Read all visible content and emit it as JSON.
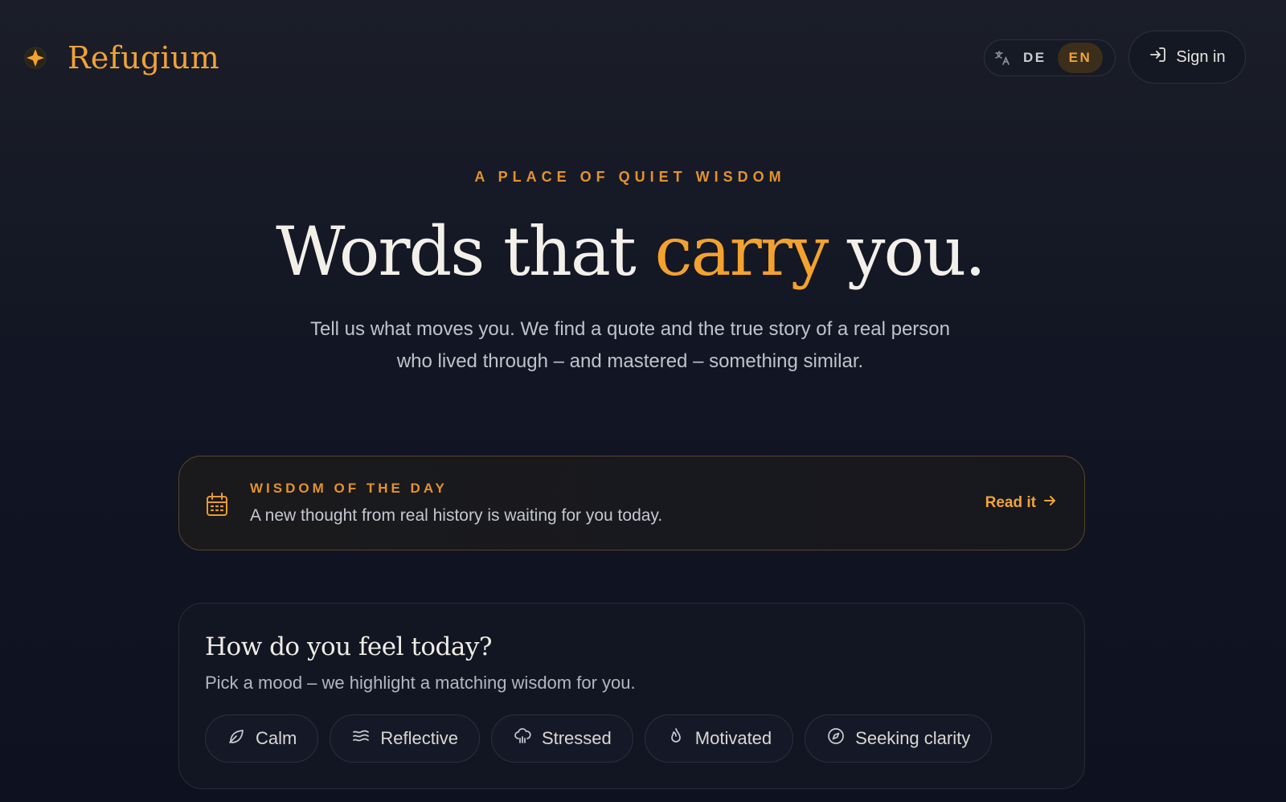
{
  "brand": {
    "name": "Refugium",
    "logo_icon": "compass-star-icon",
    "accent": "#f0a23a"
  },
  "language": {
    "icon": "translate-icon",
    "options": [
      "DE",
      "EN"
    ],
    "selected": "EN"
  },
  "signin": {
    "label": "Sign in",
    "icon": "sign-in-icon"
  },
  "hero": {
    "eyebrow": "A PLACE OF QUIET WISDOM",
    "headline_before": "Words that",
    "headline_accent": "carry",
    "headline_after": "you.",
    "subhead_line1": "Tell us what moves you. We find a quote and the true story of a real person",
    "subhead_line2": "who lived through – and mastered – something similar."
  },
  "wisdom_of_day": {
    "label": "WISDOM OF THE DAY",
    "text": "A new thought from real history is waiting for you today.",
    "link": "Read it",
    "icon": "calendar-icon"
  },
  "mood": {
    "title": "How do you feel today?",
    "subtitle": "Pick a mood – we highlight a matching wisdom for you.",
    "options": [
      {
        "label": "Calm",
        "icon": "leaf-icon"
      },
      {
        "label": "Reflective",
        "icon": "waves-icon"
      },
      {
        "label": "Stressed",
        "icon": "storm-cloud-icon"
      },
      {
        "label": "Motivated",
        "icon": "flame-icon"
      },
      {
        "label": "Seeking clarity",
        "icon": "compass-icon"
      }
    ]
  }
}
